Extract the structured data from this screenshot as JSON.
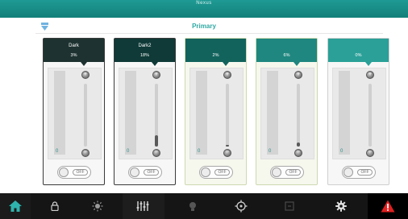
{
  "window": {
    "title": "Nexus",
    "left_text": "",
    "right_text": ""
  },
  "page": {
    "heading": "Primary"
  },
  "colors": {
    "teal": "#2ea9a3",
    "alert": "#e02020"
  },
  "channels": [
    {
      "name": "Dark",
      "value": "3%",
      "level": "0",
      "header_color": "#1e3331",
      "fill_fraction": 0.0,
      "toggle": "OFF"
    },
    {
      "name": "Dark2",
      "value": "18%",
      "level": "0",
      "header_color": "#0f3a37",
      "fill_fraction": 0.18,
      "toggle": "OFF"
    },
    {
      "name": "",
      "value": "2%",
      "level": "0",
      "header_color": "#13635d",
      "fill_fraction": 0.02,
      "toggle": "OFF"
    },
    {
      "name": "",
      "value": "6%",
      "level": "0",
      "header_color": "#1f877f",
      "fill_fraction": 0.06,
      "toggle": "OFF"
    },
    {
      "name": "",
      "value": "0%",
      "level": "0",
      "header_color": "#2aa098",
      "fill_fraction": 0.0,
      "toggle": "OFF"
    }
  ],
  "nav": {
    "items": [
      "home-icon",
      "lock-icon",
      "sun-icon",
      "sliders-icon",
      "bulb-icon",
      "target-icon",
      "square-icon",
      "gear-icon",
      "alert-icon"
    ]
  }
}
